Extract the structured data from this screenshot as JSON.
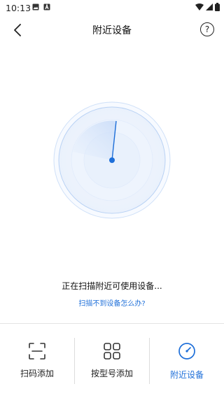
{
  "status_bar": {
    "time": "10:13"
  },
  "header": {
    "title": "附近设备"
  },
  "scan": {
    "status_text": "正在扫描附近可使用设备...",
    "help_link": "扫描不到设备怎么办?"
  },
  "bottom_nav": {
    "items": [
      {
        "label": "扫码添加",
        "icon": "scan-icon"
      },
      {
        "label": "按型号添加",
        "icon": "grid-icon"
      },
      {
        "label": "附近设备",
        "icon": "compass-icon"
      }
    ],
    "active_index": 2
  },
  "colors": {
    "accent": "#1e6fd9",
    "radar": "#d8e6fb"
  }
}
